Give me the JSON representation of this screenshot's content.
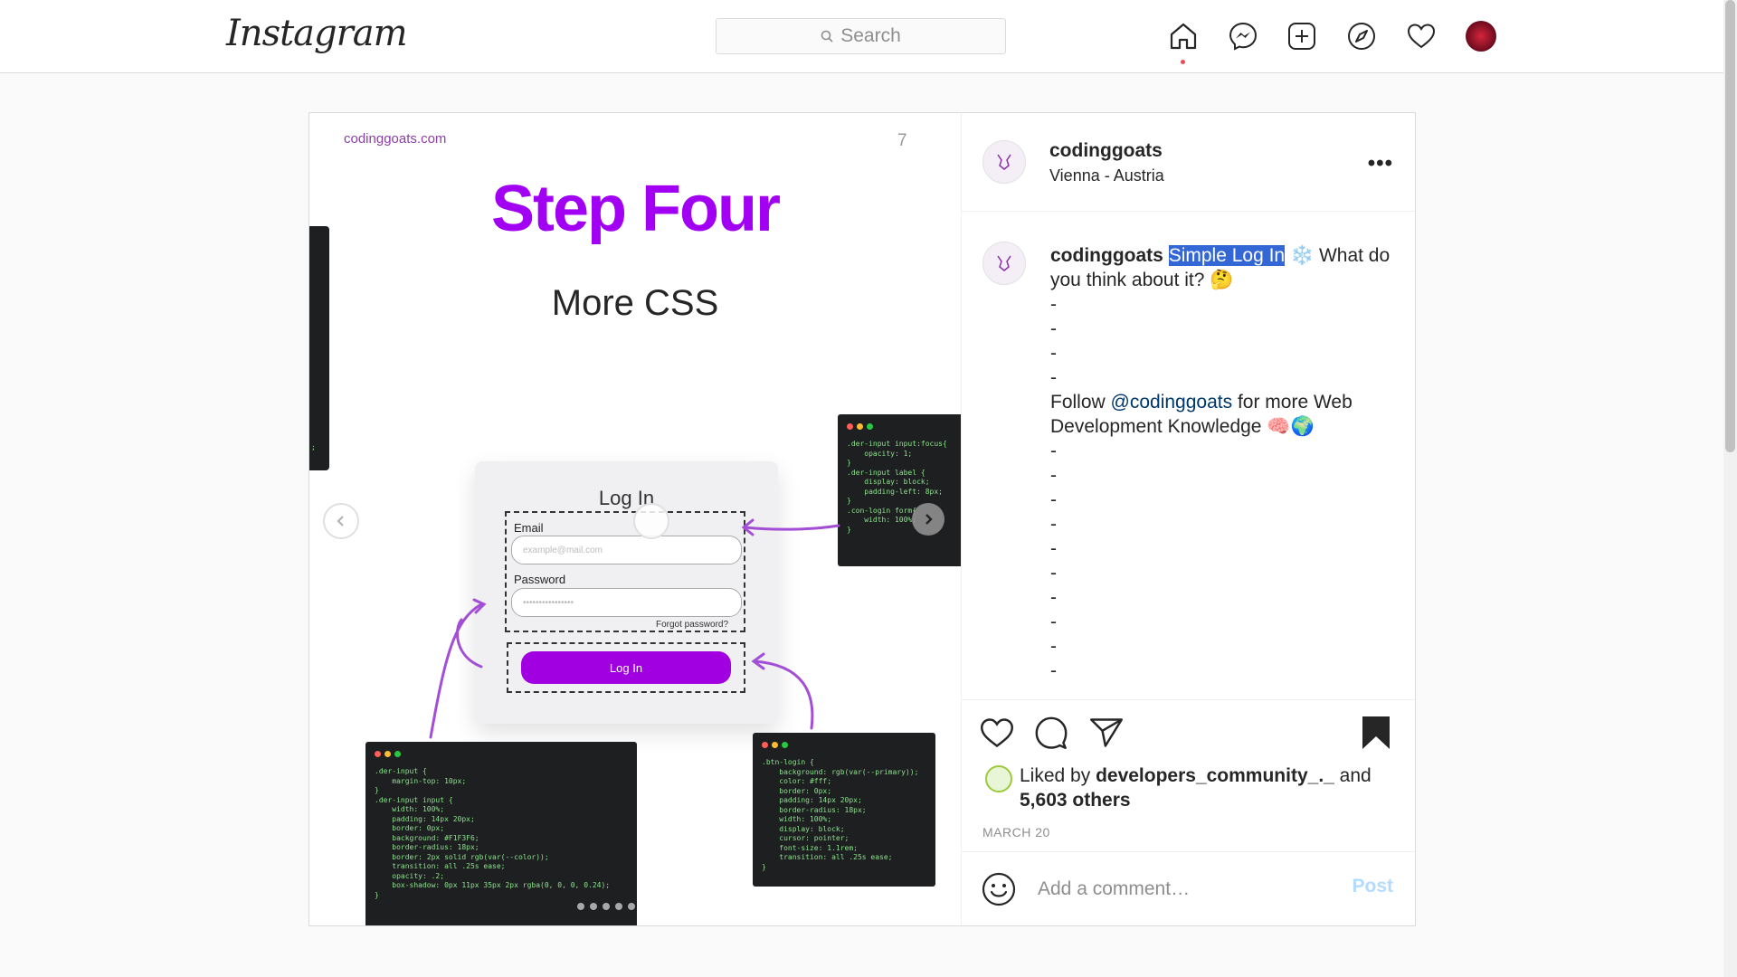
{
  "app": {
    "logo": "Instagram"
  },
  "search": {
    "placeholder": "Search"
  },
  "nav": {
    "icons": [
      "home-icon",
      "messenger-icon",
      "new-post-icon",
      "explore-icon",
      "activity-heart-icon",
      "profile-avatar"
    ],
    "home_indicator_color": "#ed4956"
  },
  "post": {
    "author": "codinggoats",
    "location": "Vienna - Austria",
    "more_label": "•••",
    "image": {
      "site": "codinggoats.com",
      "page_number": "7",
      "heading": "Step Four",
      "subheading": "More CSS",
      "heading_color": "#a100f2",
      "login": {
        "title": "Log In",
        "email_label": "Email",
        "email_placeholder": "example@mail.com",
        "password_label": "Password",
        "password_placeholder": "••••••••••••••••",
        "forgot": "Forgot password?",
        "button": "Log In"
      },
      "code_top_right": ".der-input input:focus{\n    opacity: 1;\n}\n.der-input label {\n    display: block;\n    padding-left: 8px;\n}\n.con-login form{\n    width: 100%;\n}",
      "code_bottom_left": ".der-input {\n    margin-top: 10px;\n}\n.der-input input {\n    width: 100%;\n    padding: 14px 20px;\n    border: 0px;\n    background: #F1F3F6;\n    border-radius: 18px;\n    border: 2px solid rgb(var(--color));\n    transition: all .25s ease;\n    opacity: .2;\n    box-shadow: 0px 11px 35px 2px rgba(0, 0, 0, 0.24);\n}",
      "code_bottom_right": ".btn-login {\n    background: rgb(var(--primary));\n    color: #fff;\n    border: 0px;\n    padding: 14px 20px;\n    border-radius: 18px;\n    width: 100%;\n    display: block;\n    cursor: pointer;\n    font-size: 1.1rem;\n    transition: all .25s ease;\n}",
      "code_left_edge": ";"
    },
    "caption": {
      "author": "codinggoats",
      "highlighted": "Simple Log In",
      "emoji_1": "❄️",
      "text_1": " What do you think about it? ",
      "emoji_2": "🤔",
      "dashes_top": [
        "-",
        "-",
        "-",
        "-"
      ],
      "follow_prefix": "Follow ",
      "mention": "@codinggoats",
      "follow_suffix": " for more Web Development Knowledge ",
      "emoji_3": "🧠🌍",
      "dashes_bottom": [
        "-",
        "-",
        "-",
        "-",
        "-",
        "-",
        "-",
        "-",
        "-",
        "-"
      ]
    },
    "likes": {
      "prefix": "Liked by ",
      "user": "developers_community_._",
      "middle": " and",
      "others": "5,603 others"
    },
    "date": "MARCH 20",
    "comment": {
      "placeholder": "Add a comment…",
      "post_label": "Post"
    }
  }
}
